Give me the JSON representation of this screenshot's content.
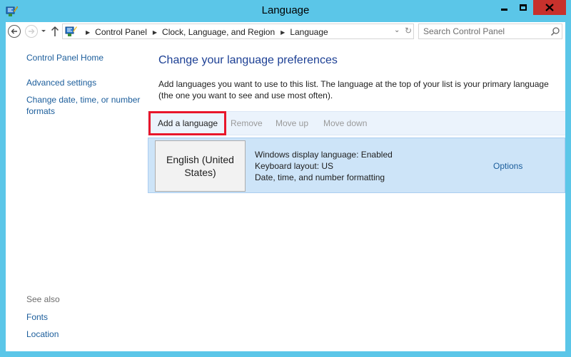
{
  "window": {
    "title": "Language"
  },
  "address_bar": {
    "crumbs": [
      "Control Panel",
      "Clock, Language, and Region",
      "Language"
    ],
    "search_placeholder": "Search Control Panel"
  },
  "left_nav": {
    "home": "Control Panel Home",
    "advanced": "Advanced settings",
    "datetime_line1": "Change date, time, or number",
    "datetime_line2": "formats",
    "see_also": "See also",
    "fonts": "Fonts",
    "location": "Location"
  },
  "main": {
    "heading": "Change your language preferences",
    "description": "Add languages you want to use to this list. The language at the top of your list is your primary language (the one you want to see and use most often).",
    "toolbar": {
      "add": "Add a language",
      "remove": "Remove",
      "move_up": "Move up",
      "move_down": "Move down"
    },
    "languages": [
      {
        "name": "English (United States)",
        "info_1": "Windows display language: Enabled",
        "info_2": "Keyboard layout: US",
        "info_3": "Date, time, and number formatting",
        "options": "Options"
      }
    ]
  },
  "colors": {
    "title_bar": "#5bc6e8",
    "close_button": "#c7312c",
    "link": "#1b5d9b",
    "heading": "#1c3f94",
    "highlight_box": "#e8162b",
    "selected_row": "#cde4f8"
  }
}
